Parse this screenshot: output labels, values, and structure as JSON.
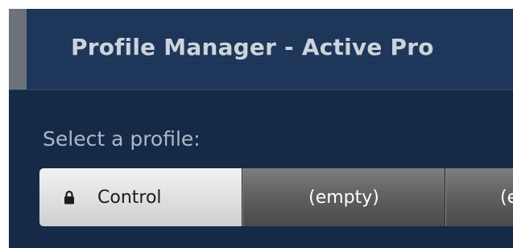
{
  "header": {
    "title": "Profile Manager - Active Pro"
  },
  "main": {
    "select_label": "Select a profile:",
    "profiles": [
      {
        "label": "Control",
        "icon": "lock-icon",
        "active": true
      },
      {
        "label": "(empty)",
        "active": false
      },
      {
        "label": "(e",
        "active": false
      }
    ]
  },
  "colors": {
    "panel_background": "#152a47",
    "header_background": "#1b3457",
    "header_accent": "#6d737c",
    "active_button": "#dfdfdf",
    "inactive_button": "#5f5f5f"
  }
}
